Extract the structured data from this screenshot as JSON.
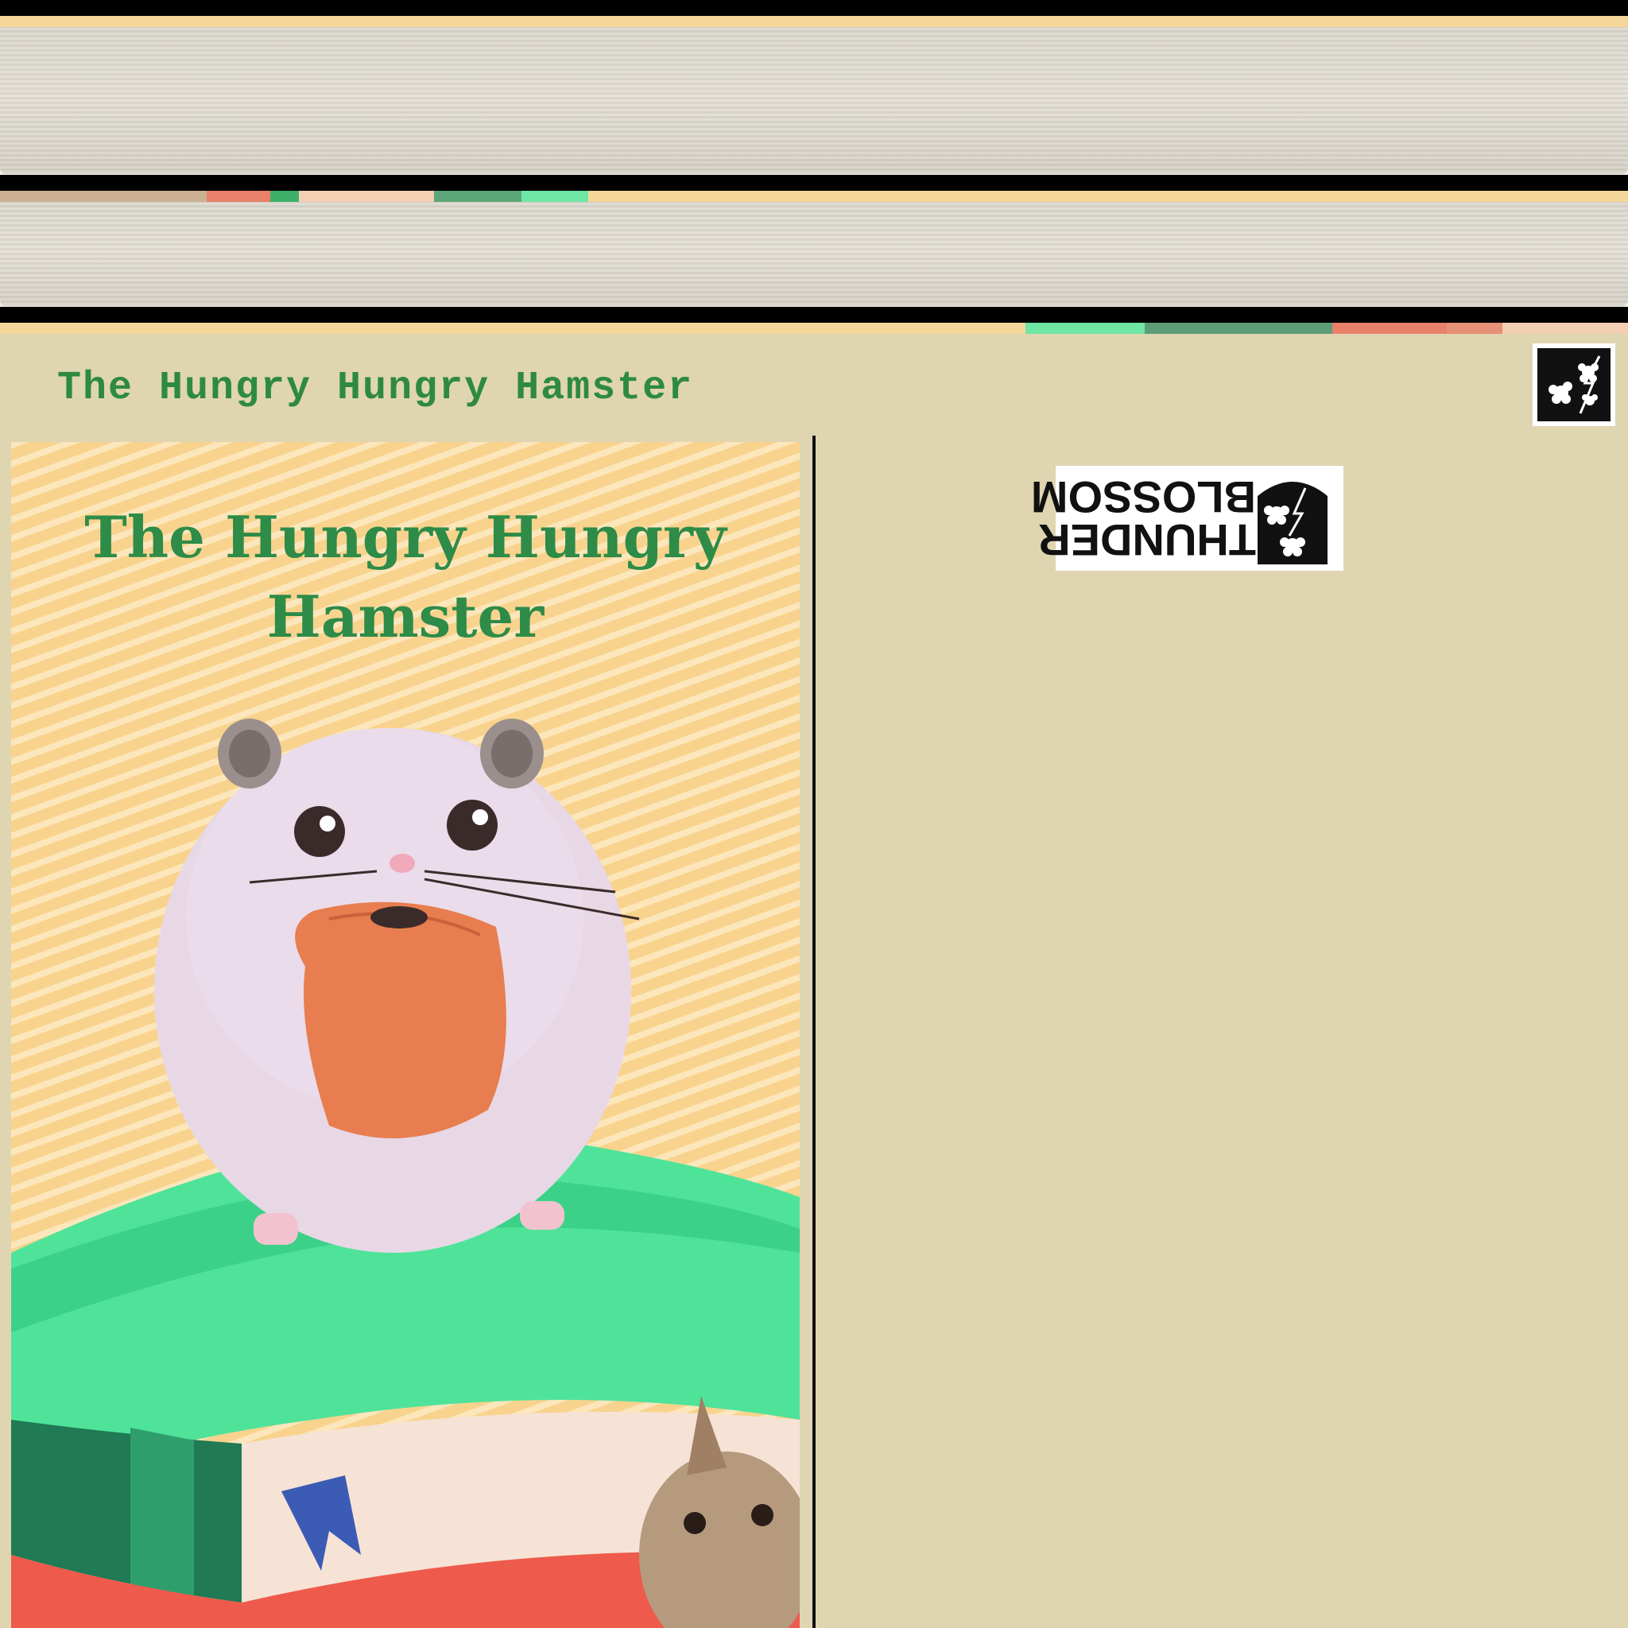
{
  "book": {
    "title": "The Hungry Hungry Hamster",
    "cover_title_line1": "The Hungry Hungry",
    "cover_title_line2": "Hamster"
  },
  "publisher": {
    "name_line1": "THUNDER",
    "name_line2": "BLOSSOM",
    "logo_icon": "thunder-blossom-emblem-icon"
  },
  "colors": {
    "title_green": "#2e8a3e",
    "panel_tan": "#e0d5b1",
    "cover_yellow": "#fbd996",
    "book_green": "#4fe39a",
    "book_red": "#ee5a4c"
  }
}
